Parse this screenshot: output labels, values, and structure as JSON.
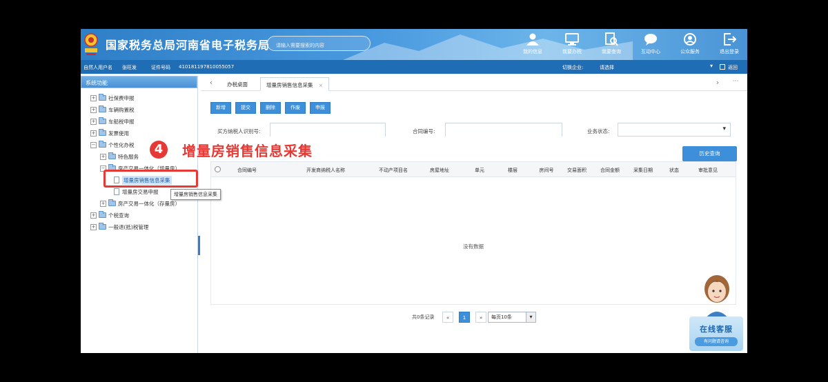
{
  "header": {
    "title": "国家税务总局河南省电子税务局",
    "search_placeholder": "请输入需要搜索的内容",
    "nav": [
      {
        "label": "我的信息",
        "icon": "user-icon"
      },
      {
        "label": "我要办税",
        "icon": "monitor-icon"
      },
      {
        "label": "我要查询",
        "icon": "search-doc-icon"
      },
      {
        "label": "互动中心",
        "icon": "chat-icon"
      },
      {
        "label": "公众服务",
        "icon": "service-icon"
      },
      {
        "label": "退出登录",
        "icon": "logout-icon"
      }
    ]
  },
  "userbar": {
    "user_label": "自然人用户名",
    "user_name": "张旺发",
    "id_label": "证件号码",
    "id_number": "410181197810055057",
    "switch_label": "切换企业:",
    "switch_value": "请选择",
    "return_label": "返回"
  },
  "sidebar": {
    "title": "系统功能",
    "items": [
      {
        "label": "社保费申报"
      },
      {
        "label": "车辆购置税"
      },
      {
        "label": "车船税申报"
      },
      {
        "label": "发票使用"
      },
      {
        "label": "个性化办税"
      },
      {
        "label": "特色服务"
      },
      {
        "label": "房产交易一体化（增量房）"
      },
      {
        "label": "增量房销售信息采集"
      },
      {
        "label": "增量房交易申报"
      },
      {
        "label": "房产交易一体化（存量房）"
      },
      {
        "label": "个税查询"
      },
      {
        "label": "一般退(抵)税管理"
      }
    ],
    "tooltip": "增量房销售信息采集"
  },
  "annotation": {
    "step": "4",
    "title": "增量房销售信息采集"
  },
  "tabs": {
    "items": [
      {
        "label": "办税桌面"
      },
      {
        "label": "增量房销售信息采集"
      }
    ],
    "close_glyph": "×"
  },
  "toolbar": {
    "buttons": [
      "新增",
      "提交",
      "删除",
      "作废",
      "申报"
    ]
  },
  "filters": {
    "buyer_label": "买方纳税人识别号:",
    "contract_label": "合同编号:",
    "status_label": "业务状态:"
  },
  "history_button": "历史查询",
  "table": {
    "columns": [
      "合同编号",
      "开发商纳税人名称",
      "不动产项目名",
      "房屋地址",
      "单元",
      "楼层",
      "房间号",
      "交易面积",
      "合同金额",
      "采集日期",
      "状态",
      "审批意见"
    ],
    "empty_text": "没有数据"
  },
  "pager": {
    "total_text": "共0条记录",
    "prev": "«",
    "current_page": "1",
    "next": "»",
    "page_size": "每页10条"
  },
  "service": {
    "title": "在线客服",
    "subtitle": "有问题请咨询"
  },
  "colors": {
    "header_blue": "#2f7fc8",
    "button_blue": "#3d8fda",
    "annotation_red": "#e53935"
  }
}
